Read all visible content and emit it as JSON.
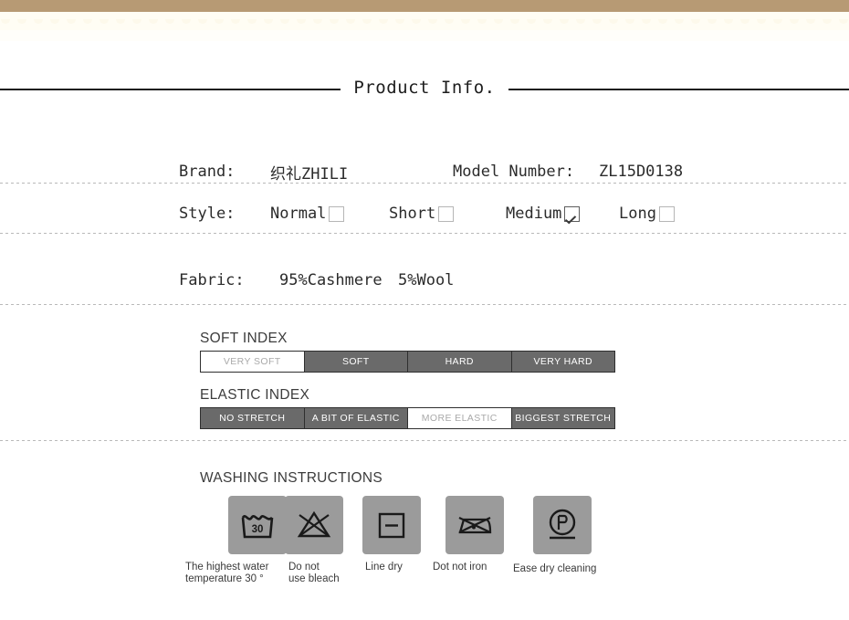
{
  "decor": {
    "top_bar_color": "#b79a74",
    "cream_band_color": "#fffdf4"
  },
  "header": {
    "title": "Product Info."
  },
  "specs": {
    "brand_label": "Brand:",
    "brand_value": "织礼ZHILI",
    "model_label": "Model Number:",
    "model_value": "ZL15D0138",
    "style_label": "Style:",
    "style_options": [
      {
        "label": "Normal",
        "checked": false
      },
      {
        "label": "Short",
        "checked": false
      },
      {
        "label": "Medium",
        "checked": true
      },
      {
        "label": "Long",
        "checked": false
      }
    ],
    "fabric_label": "Fabric:",
    "fabric_value_1": "95%Cashmere",
    "fabric_value_2": "5%Wool"
  },
  "soft_index": {
    "heading": "SOFT INDEX",
    "cells": [
      {
        "label": "VERY SOFT",
        "active": true
      },
      {
        "label": "SOFT",
        "active": false
      },
      {
        "label": "HARD",
        "active": false
      },
      {
        "label": "VERY HARD",
        "active": false
      }
    ],
    "selected": "VERY SOFT"
  },
  "elastic_index": {
    "heading": "ELASTIC INDEX",
    "cells": [
      {
        "label": "NO STRETCH",
        "active": false
      },
      {
        "label": "A BIT OF ELASTIC",
        "active": false
      },
      {
        "label": "MORE ELASTIC",
        "active": true
      },
      {
        "label": "BIGGEST STRETCH",
        "active": false
      }
    ],
    "selected": "MORE ELASTIC"
  },
  "washing": {
    "heading": "WASHING INSTRUCTIONS",
    "items": [
      {
        "icon": "wash-tub-30-icon",
        "label": "The highest water\ntemperature 30 °",
        "temperature": "30"
      },
      {
        "icon": "no-bleach-icon",
        "label": "Do not\nuse bleach"
      },
      {
        "icon": "line-dry-icon",
        "label": "Line dry"
      },
      {
        "icon": "do-not-iron-icon",
        "label": "Dot not iron"
      },
      {
        "icon": "dry-clean-p-icon",
        "label": "Ease dry cleaning"
      }
    ],
    "icon_bg_color": "#9b9b9b"
  }
}
